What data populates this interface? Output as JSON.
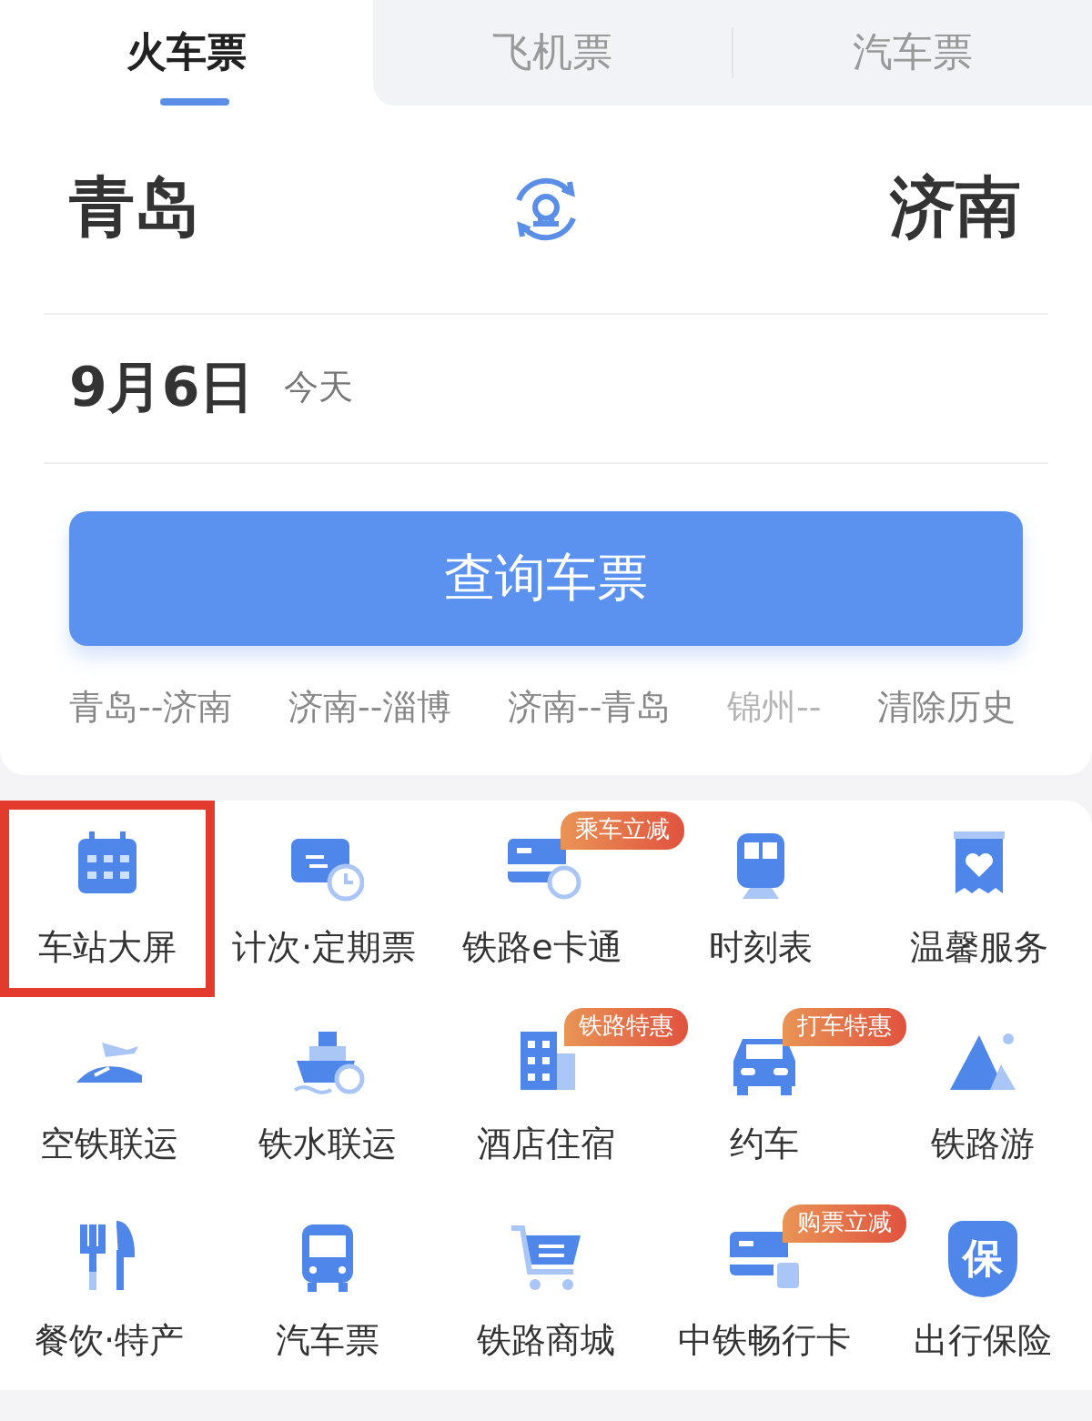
{
  "tabs": [
    {
      "label": "火车票",
      "selected": true
    },
    {
      "label": "飞机票",
      "selected": false
    },
    {
      "label": "汽车票",
      "selected": false
    }
  ],
  "route": {
    "from": "青岛",
    "to": "济南"
  },
  "date": {
    "value": "9月6日",
    "note": "今天"
  },
  "search_button": "查询车票",
  "history": [
    {
      "label": "青岛--济南",
      "faded": false
    },
    {
      "label": "济南--淄博",
      "faded": false
    },
    {
      "label": "济南--青岛",
      "faded": false
    },
    {
      "label": "锦州--",
      "faded": true
    }
  ],
  "clear_history": "清除历史",
  "services": [
    {
      "label": "车站大屏",
      "highlighted": true
    },
    {
      "label": "计次·定期票",
      "highlighted": false
    },
    {
      "label": "铁路e卡通",
      "badge": "乘车立减",
      "highlighted": false
    },
    {
      "label": "时刻表",
      "highlighted": false
    },
    {
      "label": "温馨服务",
      "highlighted": false
    },
    {
      "label": "空铁联运",
      "highlighted": false
    },
    {
      "label": "铁水联运",
      "highlighted": false
    },
    {
      "label": "酒店住宿",
      "badge": "铁路特惠",
      "highlighted": false
    },
    {
      "label": "约车",
      "badge": "打车特惠",
      "highlighted": false
    },
    {
      "label": "铁路游",
      "highlighted": false
    },
    {
      "label": "餐饮·特产",
      "highlighted": false
    },
    {
      "label": "汽车票",
      "highlighted": false
    },
    {
      "label": "铁路商城",
      "highlighted": false
    },
    {
      "label": "中铁畅行卡",
      "badge": "购票立减",
      "highlighted": false
    },
    {
      "label": "出行保险",
      "icon_text": "保",
      "highlighted": false
    }
  ]
}
